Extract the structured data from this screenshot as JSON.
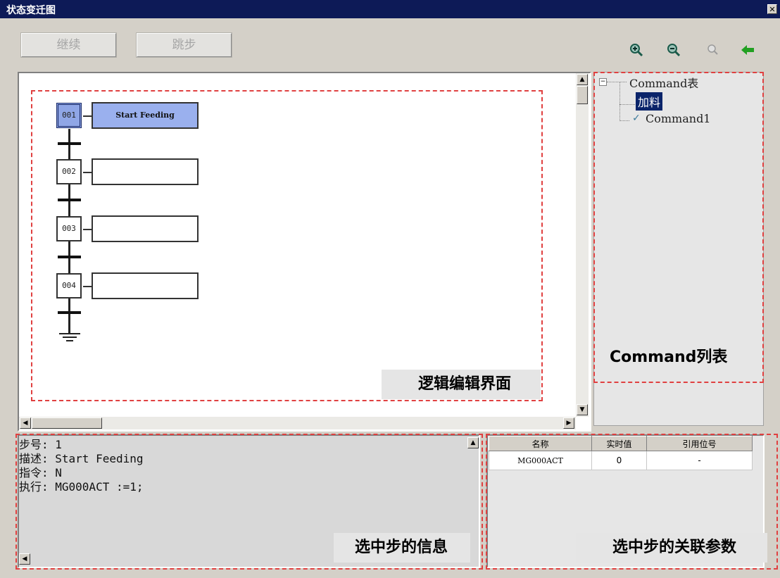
{
  "window": {
    "title": "状态变迁图",
    "close_label": "✕"
  },
  "toolbar": {
    "continue_label": "继续",
    "step_label": "跳步",
    "icons": [
      "zoom-in-icon",
      "zoom-out-icon",
      "zoom-reset-icon",
      "back-arrow-icon"
    ]
  },
  "sfc": {
    "steps": [
      {
        "number": "001",
        "action": "Start Feeding",
        "selected": true
      },
      {
        "number": "002",
        "action": ""
      },
      {
        "number": "003",
        "action": ""
      },
      {
        "number": "004",
        "action": ""
      }
    ],
    "area_label": "逻辑编辑界面"
  },
  "tree": {
    "root": "Command表",
    "items": [
      {
        "label": "加料",
        "selected": true
      },
      {
        "label": "Command1",
        "checked": true
      }
    ],
    "area_label": "Command列表"
  },
  "info": {
    "lines": [
      "步号: 1",
      "描述: Start Feeding",
      "指令: N",
      "执行: MG000ACT :=1;"
    ],
    "area_label": "选中步的信息"
  },
  "params": {
    "headers": [
      "名称",
      "实时值",
      "引用位号"
    ],
    "rows": [
      {
        "name": "MG000ACT",
        "value": "0",
        "ref": "-"
      }
    ],
    "area_label": "选中步的关联参数"
  },
  "colors": {
    "titlebar": "#0d1a57",
    "selected_step": "#9ab0ee",
    "annotation_border": "#e04040",
    "tree_selected": "#0a246a"
  }
}
